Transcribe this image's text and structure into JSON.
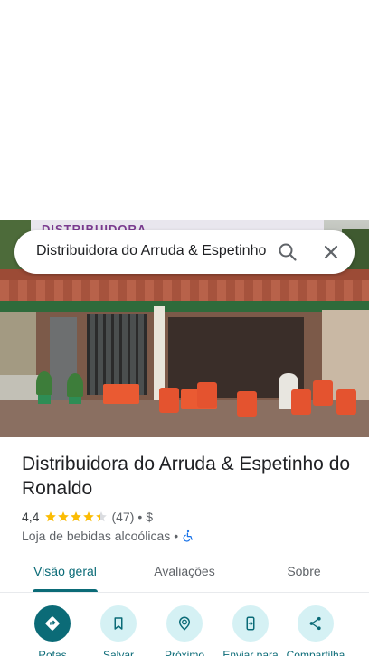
{
  "search": {
    "query": "Distribuidora do Arruda & Espetinho"
  },
  "photo": {
    "sign_text": "DISTRIBUIDORA"
  },
  "place": {
    "name": "Distribuidora do Arruda & Espetinho do Ronaldo",
    "rating": "4,4",
    "stars": 4.4,
    "review_count": "(47)",
    "separator": "•",
    "price": "$",
    "category": "Loja de bebidas alcoólicas",
    "category_separator": "•",
    "accessibility_icon": "wheelchair-icon"
  },
  "tabs": [
    {
      "label": "Visão geral",
      "active": true
    },
    {
      "label": "Avaliações",
      "active": false
    },
    {
      "label": "Sobre",
      "active": false
    }
  ],
  "actions": [
    {
      "label": "Rotas",
      "icon": "directions-icon"
    },
    {
      "label": "Salvar",
      "icon": "bookmark-icon"
    },
    {
      "label": "Próximo",
      "icon": "nearby-icon"
    },
    {
      "label": "Enviar para",
      "icon": "send-to-phone-icon"
    },
    {
      "label": "Compartilha",
      "icon": "share-icon"
    }
  ],
  "colors": {
    "accent": "#0b6b77",
    "accent_light": "#d5f1f4",
    "star": "#fbbc04",
    "text_primary": "#202124",
    "text_secondary": "#5f6368",
    "accessibility": "#1a73e8"
  }
}
